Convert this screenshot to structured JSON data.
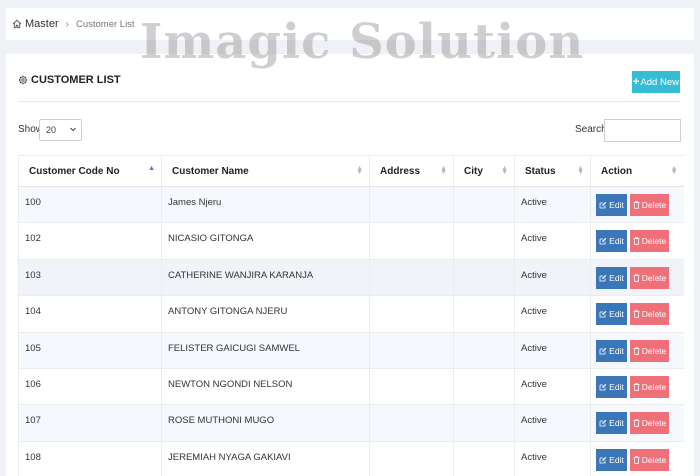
{
  "breadcrumb": {
    "home": "Master",
    "separator": "›",
    "current": "Customer List"
  },
  "watermark": "Imagic Solution",
  "card": {
    "title": "CUSTOMER LIST",
    "add_button": "Add New"
  },
  "controls": {
    "show_label": "Show",
    "page_size": "20",
    "search_label": "Search:",
    "search_value": ""
  },
  "table": {
    "columns": [
      "Customer Code No",
      "Customer Name",
      "Address",
      "City",
      "Status",
      "Action"
    ],
    "rows": [
      {
        "code": "100",
        "name": "James Njeru",
        "address": "",
        "city": "",
        "status": "Active"
      },
      {
        "code": "102",
        "name": "NICASIO GITONGA",
        "address": "",
        "city": "",
        "status": "Active"
      },
      {
        "code": "103",
        "name": "CATHERINE WANJIRA KARANJA",
        "address": "",
        "city": "",
        "status": "Active"
      },
      {
        "code": "104",
        "name": "ANTONY GITONGA NJERU",
        "address": "",
        "city": "",
        "status": "Active"
      },
      {
        "code": "105",
        "name": "FELISTER GAICUGI SAMWEL",
        "address": "",
        "city": "",
        "status": "Active"
      },
      {
        "code": "106",
        "name": "NEWTON NGONDI NELSON",
        "address": "",
        "city": "",
        "status": "Active"
      },
      {
        "code": "107",
        "name": "ROSE MUTHONI MUGO",
        "address": "",
        "city": "",
        "status": "Active"
      },
      {
        "code": "108",
        "name": "JEREMIAH NYAGA GAKIAVI",
        "address": "",
        "city": "",
        "status": "Active"
      }
    ],
    "edit_label": "Edit",
    "delete_label": "Delete"
  },
  "colors": {
    "add_button": "#36bdd6",
    "edit_button": "#3a76b8",
    "delete_button": "#f0707a",
    "sort_active": "#5b6cc2"
  },
  "icons": {
    "home": "home-icon",
    "title": "gear-icon",
    "add": "plus-icon",
    "edit": "edit-icon",
    "delete": "trash-icon"
  }
}
